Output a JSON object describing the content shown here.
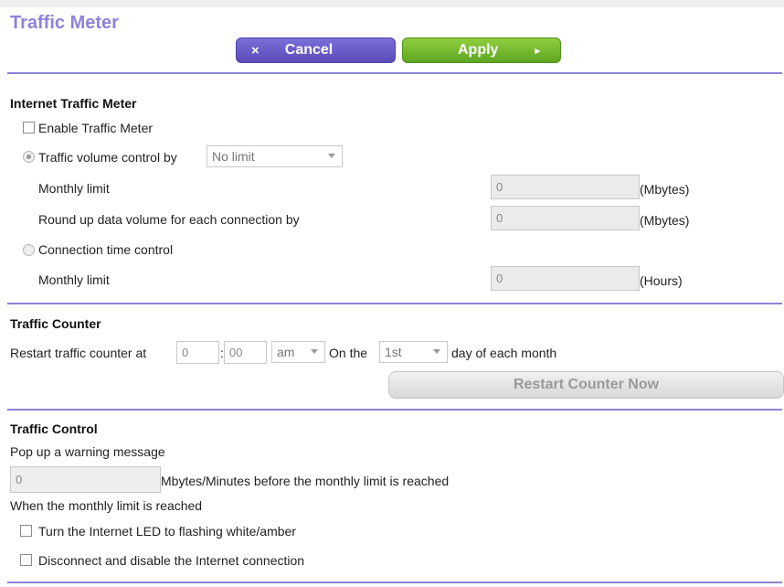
{
  "page": {
    "title": "Traffic Meter"
  },
  "toolbar": {
    "cancel_label": "Cancel",
    "cancel_icon": "×",
    "apply_label": "Apply",
    "apply_icon": "▸"
  },
  "internet_meter": {
    "section_title": "Internet Traffic Meter",
    "enable_label": "Enable Traffic Meter",
    "volume_label": "Traffic volume control by",
    "volume_select": "No limit",
    "monthly_limit_label": "Monthly limit",
    "monthly_limit_value": "0",
    "mbytes_unit": "(Mbytes)",
    "roundup_label": "Round up data volume for each connection by",
    "roundup_value": "0",
    "roundup_unit": "(Mbytes)",
    "time_control_label": "Connection time control",
    "time_monthly_limit_label": "Monthly limit",
    "time_monthly_limit_value": "0",
    "hours_unit": "(Hours)"
  },
  "traffic_counter": {
    "section_title": "Traffic Counter",
    "restart_label": "Restart traffic counter at",
    "hour_value": "0",
    "minute_value": "00",
    "colon": ":",
    "ampm_select": "am",
    "on_the_label": "On the",
    "day_select": "1st",
    "day_suffix": "day of each month",
    "restart_button": "Restart Counter Now"
  },
  "traffic_control": {
    "section_title": "Traffic Control",
    "popup_label": "Pop up a warning message",
    "warning_value": "0",
    "warning_suffix": "Mbytes/Minutes before the monthly limit is reached",
    "when_reached_label": "When the monthly limit is reached",
    "led_label": "Turn the Internet LED to flashing white/amber",
    "disconnect_label": "Disconnect and disable the Internet connection"
  },
  "colors": {
    "accent": "#8e82dd",
    "cancel_button": "#6a5ec8",
    "apply_button": "#76bd31",
    "divider": "#8c83d6"
  }
}
